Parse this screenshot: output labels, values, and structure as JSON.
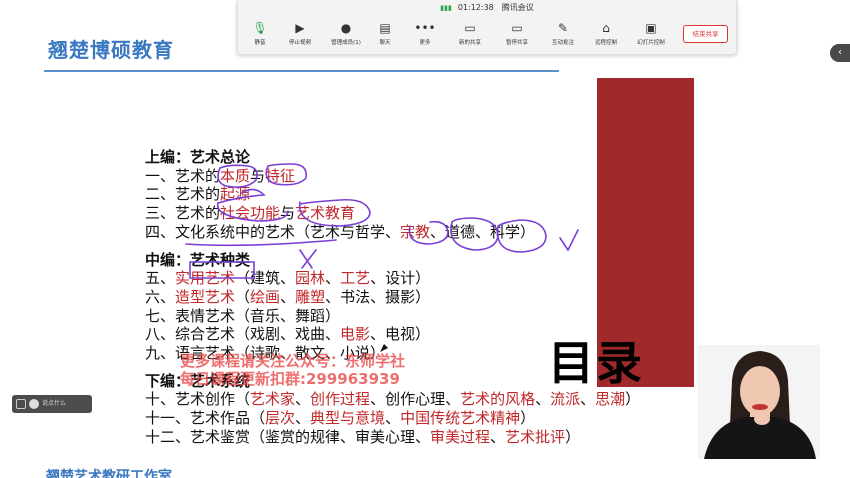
{
  "toolbar": {
    "time": "01:12:38",
    "app_name": "腾讯会议",
    "buttons": [
      {
        "label": "静音",
        "icon": "microphone-icon"
      },
      {
        "label": "停止视频",
        "icon": "video-camera-icon"
      },
      {
        "label": "管理成员(1)",
        "icon": "members-icon"
      },
      {
        "label": "聊天",
        "icon": "chat-icon"
      },
      {
        "label": "更多",
        "icon": "more-icon"
      },
      {
        "label": "新的共享",
        "icon": "new-share-icon"
      },
      {
        "label": "暂停共享",
        "icon": "pause-share-icon"
      },
      {
        "label": "互动批注",
        "icon": "annotate-icon"
      },
      {
        "label": "远程控制",
        "icon": "remote-control-icon"
      },
      {
        "label": "幻灯片控制",
        "icon": "slides-control-icon"
      }
    ],
    "end_share": "结束共享"
  },
  "slide": {
    "brand": "翘楚博硕教育",
    "toc_label": "目录",
    "footer": "翘楚艺术教研工作室",
    "watermark": {
      "line1": "更多课程请关注公众号：东师学社",
      "line2": "每日课程更新扣群:299963939"
    },
    "outline": [
      {
        "type": "section",
        "text": "上编：艺术总论"
      },
      {
        "type": "row",
        "parts": [
          {
            "t": "一、艺术的"
          },
          {
            "t": "本质",
            "hl": true
          },
          {
            "t": "与"
          },
          {
            "t": "特征",
            "hl": true
          }
        ]
      },
      {
        "type": "row",
        "parts": [
          {
            "t": "二、艺术的"
          },
          {
            "t": "起源",
            "hl": true
          }
        ]
      },
      {
        "type": "row",
        "parts": [
          {
            "t": "三、艺术的"
          },
          {
            "t": "社会功能",
            "hl": true
          },
          {
            "t": "与"
          },
          {
            "t": "艺术教育",
            "hl": true
          }
        ]
      },
      {
        "type": "row",
        "parts": [
          {
            "t": "四、文化系统中的艺术（艺术与哲学、"
          },
          {
            "t": "宗教",
            "hl": true
          },
          {
            "t": "、道德、科学）"
          }
        ]
      },
      {
        "type": "gap"
      },
      {
        "type": "section",
        "text": "中编：艺术种类"
      },
      {
        "type": "row",
        "parts": [
          {
            "t": "五、"
          },
          {
            "t": "实用艺术",
            "hl": true
          },
          {
            "t": "（建筑、"
          },
          {
            "t": "园林",
            "hl": true
          },
          {
            "t": "、"
          },
          {
            "t": "工艺",
            "hl": true
          },
          {
            "t": "、设计）"
          }
        ]
      },
      {
        "type": "row",
        "parts": [
          {
            "t": "六、"
          },
          {
            "t": "造型艺术",
            "hl": true
          },
          {
            "t": "（"
          },
          {
            "t": "绘画",
            "hl": true
          },
          {
            "t": "、"
          },
          {
            "t": "雕塑",
            "hl": true
          },
          {
            "t": "、书法、摄影）"
          }
        ]
      },
      {
        "type": "row",
        "parts": [
          {
            "t": "七、表情艺术（音乐、舞蹈）"
          }
        ]
      },
      {
        "type": "row",
        "parts": [
          {
            "t": "八、综合艺术（戏剧、戏曲、"
          },
          {
            "t": "电影",
            "hl": true
          },
          {
            "t": "、电视）"
          }
        ]
      },
      {
        "type": "row",
        "parts": [
          {
            "t": "九、语言艺术（诗歌、散文、小说）"
          }
        ]
      },
      {
        "type": "gap"
      },
      {
        "type": "section",
        "text": "下编：艺术系统"
      },
      {
        "type": "row",
        "parts": [
          {
            "t": "十、艺术创作（"
          },
          {
            "t": "艺术家",
            "hl": true
          },
          {
            "t": "、"
          },
          {
            "t": "创作过程",
            "hl": true
          },
          {
            "t": "、创作心理、"
          },
          {
            "t": "艺术的风格",
            "hl": true
          },
          {
            "t": "、"
          },
          {
            "t": "流派",
            "hl": true
          },
          {
            "t": "、"
          },
          {
            "t": "思潮",
            "hl": true
          },
          {
            "t": "）"
          }
        ]
      },
      {
        "type": "row",
        "parts": [
          {
            "t": "十一、艺术作品（"
          },
          {
            "t": "层次",
            "hl": true
          },
          {
            "t": "、"
          },
          {
            "t": "典型与意境",
            "hl": true
          },
          {
            "t": "、"
          },
          {
            "t": "中国传统艺术精神",
            "hl": true
          },
          {
            "t": "）"
          }
        ]
      },
      {
        "type": "row",
        "parts": [
          {
            "t": "十二、艺术鉴赏（鉴赏的规律、审美心理、"
          },
          {
            "t": "审美过程",
            "hl": true
          },
          {
            "t": "、"
          },
          {
            "t": "艺术批评",
            "hl": true
          },
          {
            "t": "）"
          }
        ]
      }
    ]
  },
  "chat_chip": {
    "placeholder": "说点什么"
  },
  "side_tab": {
    "icon": "chevron-left-icon",
    "glyph": "‹"
  },
  "colors": {
    "accent": "#3a79c2",
    "highlight": "#c0282a",
    "toc_bar": "#a1282b",
    "ink": "#7b3fd6"
  }
}
